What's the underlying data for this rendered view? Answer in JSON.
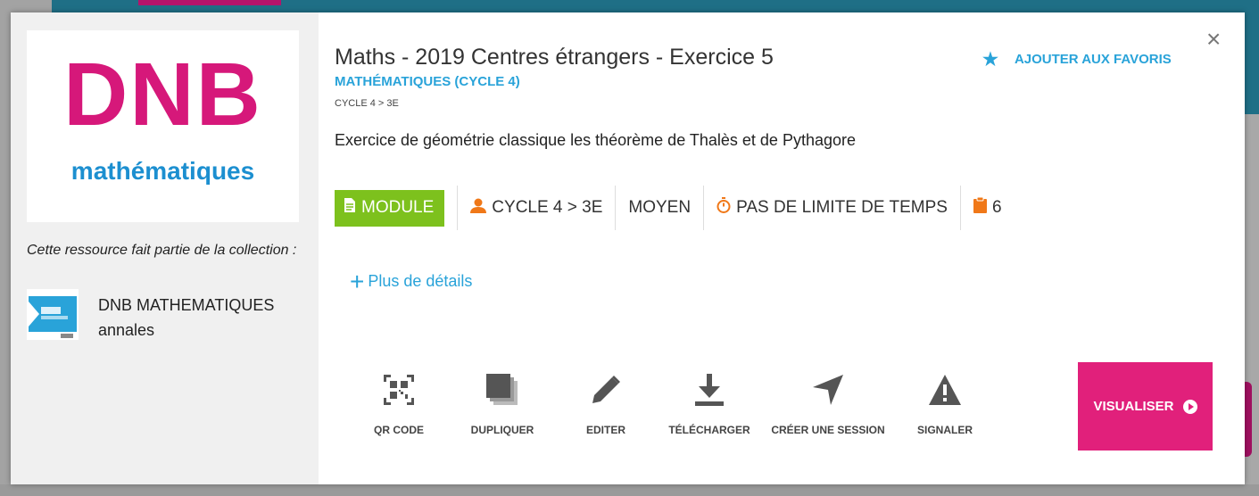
{
  "modal": {
    "title": "Maths - 2019 Centres étrangers - Exercice 5",
    "subject": "MATHÉMATIQUES (CYCLE 4)",
    "breadcrumb": "CYCLE 4 > 3E",
    "favorite_label": "AJOUTER AUX FAVORIS",
    "close_glyph": "×",
    "description": "Exercice de géométrie classique les théorème de Thalès et de Pythagore",
    "logo": {
      "main": "DNB",
      "sub": "mathématiques"
    },
    "collection_note": "Cette ressource fait partie de la collection :",
    "collection_title_line1": "DNB MATHEMATIQUES",
    "collection_title_line2": "annales",
    "meta": {
      "type": "MODULE",
      "level": "CYCLE 4 > 3E",
      "difficulty": "MOYEN",
      "time": "PAS DE LIMITE DE TEMPS",
      "count": "6"
    },
    "details_label": "Plus de détails",
    "actions": [
      {
        "label": "QR CODE",
        "icon": "qr-code-icon"
      },
      {
        "label": "DUPLIQUER",
        "icon": "duplicate-icon"
      },
      {
        "label": "EDITER",
        "icon": "pencil-icon"
      },
      {
        "label": "TÉLÉCHARGER",
        "icon": "download-icon"
      },
      {
        "label": "CRÉER UNE SESSION",
        "icon": "navigation-arrow-icon"
      },
      {
        "label": "SIGNALER",
        "icon": "warning-icon"
      }
    ],
    "visualiser_label": "VISUALISER"
  },
  "colors": {
    "accent": "#29a3d9",
    "module": "#7dc11d",
    "pink": "#e1207b",
    "orange": "#f07818"
  }
}
